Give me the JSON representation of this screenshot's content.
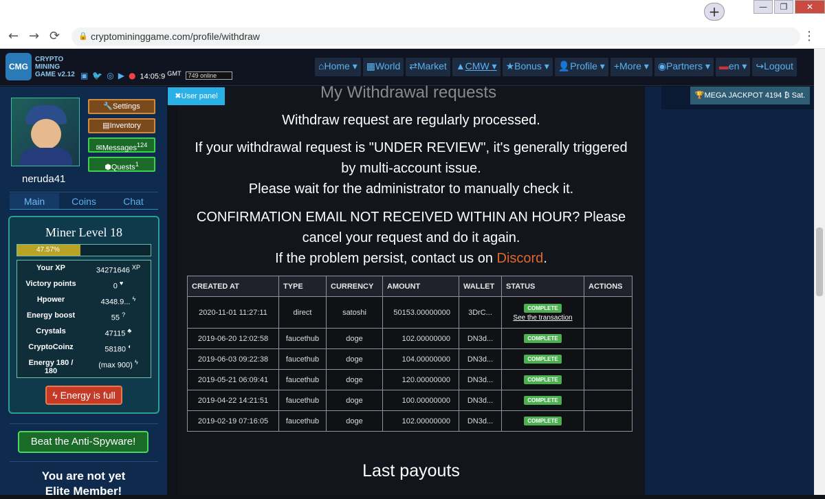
{
  "browser": {
    "new_tab": "+",
    "win_min": "—",
    "win_max": "❐",
    "win_close": "✕",
    "back": "←",
    "forward": "→",
    "reload": "⟳",
    "url": "cryptomininggame.com/profile/withdraw",
    "menu": "⋮"
  },
  "nav": {
    "logo": "CMG",
    "brand_line1": "CRYPTO",
    "brand_line2": "MINING",
    "brand_line3": "GAME v2.12",
    "clock": "14:05:9",
    "clock_tz": "GMT",
    "online": "749 online",
    "menu": [
      "Home ▾",
      "World",
      "Market",
      "CMW ▾",
      "Bonus ▾",
      "Profile ▾",
      "More ▾",
      "Partners ▾",
      "en ▾",
      "Logout"
    ],
    "menu_icons": [
      "⌂",
      "▦",
      "⇄",
      "▲",
      "★",
      "👤",
      "+",
      "◉",
      "▬",
      "↪"
    ]
  },
  "sidebar": {
    "username": "neruda41",
    "buttons": {
      "settings": "Settings",
      "inventory": "Inventory",
      "messages": "Messages",
      "messages_count": "124",
      "quests": "Quests",
      "quests_count": "1"
    },
    "tabs": [
      "Main",
      "Coins",
      "Chat"
    ],
    "miner_level": "Miner Level 18",
    "xp_percent_text": "47.57%",
    "xp_percent": 47.57,
    "stats": [
      {
        "label": "Your XP",
        "value": "34271646",
        "unit": "XP"
      },
      {
        "label": "Victory points",
        "value": "0",
        "unit": "♥"
      },
      {
        "label": "Hpower",
        "value": "4348.9...",
        "unit": "ϟ"
      },
      {
        "label": "Energy boost",
        "value": "55",
        "unit": "?"
      },
      {
        "label": "Crystals",
        "value": "47115",
        "unit": "♣"
      },
      {
        "label": "CryptoCoinz",
        "value": "58180",
        "unit": "◐"
      },
      {
        "label": "Energy 180 / 180",
        "value": "(max 900)",
        "unit": "ϟ"
      }
    ],
    "energy_full": "Energy is full",
    "spyware": "Beat the Anti-Spyware!",
    "elite_line1": "You are not yet",
    "elite_line2": "Elite Member!"
  },
  "user_panel": "✖User panel",
  "jackpot": "MEGA JACKPOT 4194 ₿ Sat.",
  "page_title": "My Withdrawal requests",
  "messages": {
    "line1": "Withdraw request are regularly processed.",
    "line2": "If your withdrawal request is \"UNDER REVIEW\", it's generally triggered",
    "line3": "by multi-account issue.",
    "line4": "Please wait for the administrator to manually check it.",
    "line5": "CONFIRMATION EMAIL NOT RECEIVED WITHIN AN HOUR? Please",
    "line6": "cancel your request and do it again.",
    "line7a": "If the problem persist, contact us on ",
    "line7_link": "Discord",
    "line7b": "."
  },
  "table": {
    "headers": [
      "CREATED AT",
      "TYPE",
      "CURRENCY",
      "AMOUNT",
      "WALLET",
      "STATUS",
      "ACTIONS"
    ],
    "rows": [
      {
        "created": "2020-11-01 11:27:11",
        "type": "direct",
        "currency": "satoshi",
        "amount": "50153.00000000",
        "wallet": "3DrC...",
        "status": "COMPLETE",
        "link": "See the transaction"
      },
      {
        "created": "2019-06-20 12:02:58",
        "type": "faucethub",
        "currency": "doge",
        "amount": "102.00000000",
        "wallet": "DN3d...",
        "status": "COMPLETE"
      },
      {
        "created": "2019-06-03 09:22:38",
        "type": "faucethub",
        "currency": "doge",
        "amount": "104.00000000",
        "wallet": "DN3d...",
        "status": "COMPLETE"
      },
      {
        "created": "2019-05-21 06:09:41",
        "type": "faucethub",
        "currency": "doge",
        "amount": "120.00000000",
        "wallet": "DN3d...",
        "status": "COMPLETE"
      },
      {
        "created": "2019-04-22 14:21:51",
        "type": "faucethub",
        "currency": "doge",
        "amount": "100.00000000",
        "wallet": "DN3d...",
        "status": "COMPLETE"
      },
      {
        "created": "2019-02-19 07:16:05",
        "type": "faucethub",
        "currency": "doge",
        "amount": "102.00000000",
        "wallet": "DN3d...",
        "status": "COMPLETE"
      }
    ]
  },
  "last_payouts": "Last payouts",
  "colors": {
    "accent": "#5ab0ee",
    "discord": "#e3672d",
    "complete": "#4caf50"
  }
}
